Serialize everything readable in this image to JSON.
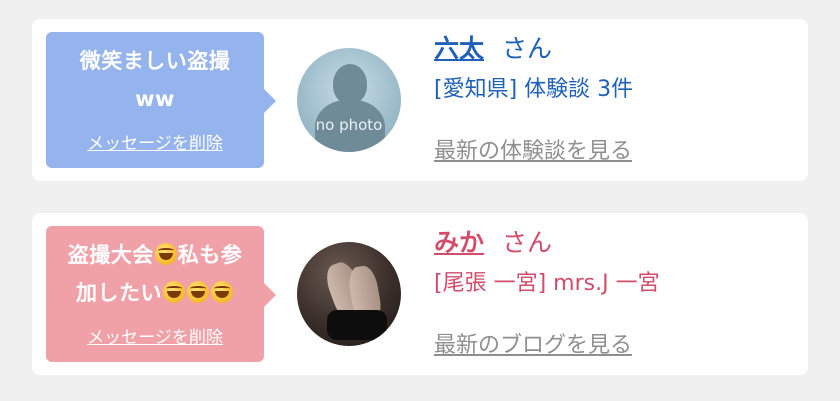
{
  "entries": [
    {
      "message_line1": "微笑ましい盗撮",
      "message_line2": "ww",
      "delete_label": "メッセージを削除",
      "name": "六太",
      "honorific": "さん",
      "detail": "[愛知県] 体験談 3件",
      "latest_link": "最新の体験談を見る",
      "avatar_text": "no photo",
      "bubble_color": "#95b3ed",
      "name_color": "#1f61b8"
    },
    {
      "message_line1_a": "盗撮大会",
      "message_line1_b": "私も参",
      "message_line2": "加したい",
      "emoji": "rolling-on-floor-laughing-emoji",
      "delete_label": "メッセージを削除",
      "name": "みか",
      "honorific": "さん",
      "detail": "[尾張 一宮] mrs.J 一宮",
      "latest_link": "最新のブログを見る",
      "bubble_color": "#f0a1a8",
      "name_color": "#d24d6a"
    }
  ]
}
